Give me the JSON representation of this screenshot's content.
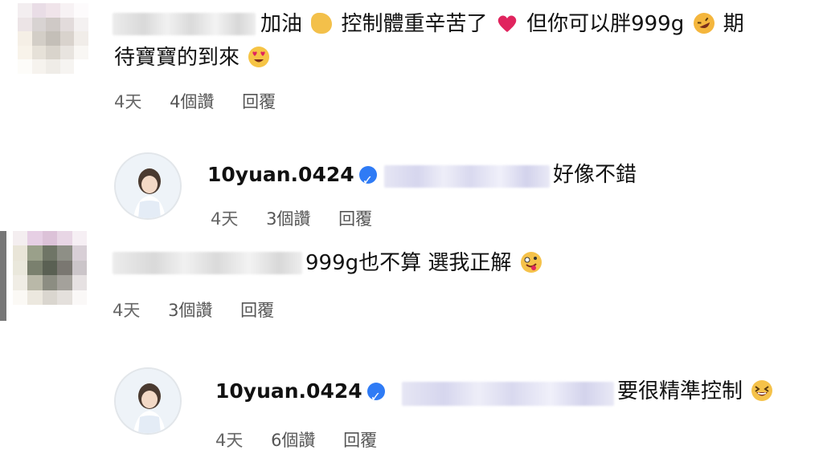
{
  "comments": [
    {
      "text_line1": "加油",
      "text_part2": "控制體重辛苦了",
      "text_part3": "但你可以胖999g",
      "text_part4": "期",
      "text_line2": "待寶寶的到來",
      "time": "4天",
      "likes": "4個讚",
      "reply": "回覆"
    },
    {
      "username": "10yuan.0424",
      "text": "好像不錯",
      "time": "4天",
      "likes": "3個讚",
      "reply": "回覆"
    },
    {
      "text": "999g也不算 選我正解",
      "time": "4天",
      "likes": "3個讚",
      "reply": "回覆"
    },
    {
      "username": "10yuan.0424",
      "text": "要很精準控制",
      "time": "4天",
      "likes": "6個讚",
      "reply": "回覆"
    }
  ],
  "colors": {
    "verified_badge": "#2f7bf5",
    "meta_text": "#666666",
    "heart": "#e0245e"
  },
  "icons": [
    "clapping-hands-emoji",
    "red-heart-emoji",
    "rofl-emoji",
    "heart-eyes-emoji",
    "zany-face-emoji",
    "grinning-squinting-emoji",
    "verified-badge-icon"
  ]
}
